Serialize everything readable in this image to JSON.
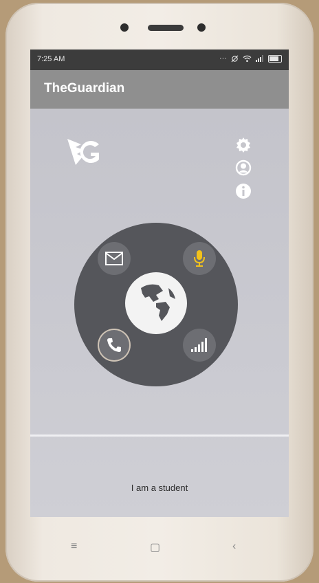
{
  "status_bar": {
    "time": "7:25 AM",
    "icons": [
      "more-icon",
      "alarm-off-icon",
      "wifi-icon",
      "signal-icon",
      "battery-icon"
    ]
  },
  "app_bar": {
    "title": "TheGuardian"
  },
  "content": {
    "caption": "I am a student",
    "wheel_buttons": [
      "mail-icon",
      "mic-icon",
      "phone-icon",
      "signal-bars-icon"
    ],
    "center_icon": "globe-icon",
    "side_icons": [
      "settings-icon",
      "profile-icon",
      "info-icon"
    ]
  },
  "colors": {
    "mic_accent": "#f2c21b",
    "wheel": "#55565b",
    "app_bar": "#8f8f8f"
  },
  "nav_keys": {
    "menu": "≡",
    "home": "▢",
    "back": "‹"
  }
}
